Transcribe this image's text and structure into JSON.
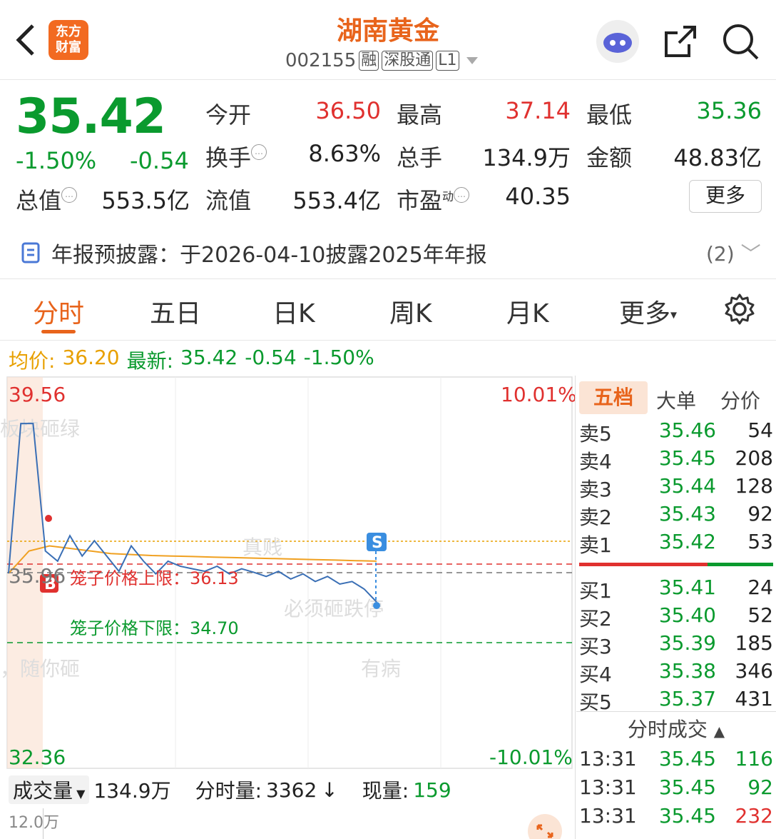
{
  "header": {
    "back_icon": "chevron-left-icon",
    "logo_text_line1": "东方",
    "logo_text_line2": "财富",
    "title": "湖南黄金",
    "code": "002155",
    "tags": [
      "融",
      "深股通",
      "L1"
    ],
    "icons": [
      "robot-avatar-icon",
      "share-icon",
      "search-icon"
    ]
  },
  "quote": {
    "price": "35.42",
    "change_pct": "-1.50%",
    "change_abs": "-0.54",
    "open_label": "今开",
    "open_value": "36.50",
    "high_label": "最高",
    "high_value": "37.14",
    "low_label": "最低",
    "low_value": "35.36",
    "turnover_label": "换手",
    "turnover_value": "8.63%",
    "volume_label": "总手",
    "volume_value": "134.9万",
    "amount_label": "金额",
    "amount_value": "48.83亿",
    "mktcap_label": "总值",
    "mktcap_value": "553.5亿",
    "float_label": "流值",
    "float_value": "553.4亿",
    "pe_label": "市盈",
    "pe_sup": "动",
    "pe_value": "40.35",
    "more_label": "更多"
  },
  "notice": {
    "text": "年报预披露：于2026-04-10披露2025年年报",
    "count": "(2)"
  },
  "tabs": [
    "分时",
    "五日",
    "日K",
    "周K",
    "月K",
    "更多"
  ],
  "avg": {
    "avg_label": "均价:",
    "avg_value": "36.20",
    "latest_label": "最新:",
    "latest_value": "35.42",
    "chg": "-0.54",
    "pct": "-1.50%"
  },
  "chart_labels": {
    "top_price": "39.56",
    "top_pct": "10.01%",
    "bottom_price": "32.36",
    "bottom_pct": "-10.01%",
    "ref_price": "35.96",
    "cage_upper": "笼子价格上限：36.13",
    "cage_lower": "笼子价格下限：34.70",
    "marker_s": "S",
    "marker_b": "B",
    "watermark_1": "板块砸绿",
    "watermark_2": "真贱",
    "watermark_3": "必须砸跌停",
    "watermark_4": "，随你砸",
    "watermark_5": "有病"
  },
  "chart_data": {
    "type": "line",
    "series": [
      {
        "values": [
          35.96,
          38.9,
          38.9,
          36.4,
          36.2,
          36.7,
          36.3,
          36.6,
          36.3,
          36.0,
          36.5,
          36.2,
          35.95,
          36.2,
          36.1,
          36.05,
          36.0,
          36.1,
          35.95,
          36.05,
          35.98,
          35.9,
          36.0,
          35.85,
          35.95,
          35.8,
          35.9,
          35.75,
          35.8,
          35.65,
          35.4
        ]
      },
      {
        "values": [
          35.96,
          36.4,
          36.5,
          36.45,
          36.4,
          36.35,
          36.33,
          36.31,
          36.3,
          36.29,
          36.28,
          36.27,
          36.26,
          36.25,
          36.24,
          36.23,
          36.22,
          36.21,
          36.2
        ]
      }
    ],
    "ylim": [
      32.36,
      39.56
    ],
    "grid": true
  },
  "orderbook": {
    "tabs": [
      "五档",
      "大单",
      "分价"
    ],
    "asks": [
      {
        "label": "卖5",
        "price": "35.46",
        "vol": "54"
      },
      {
        "label": "卖4",
        "price": "35.45",
        "vol": "208"
      },
      {
        "label": "卖3",
        "price": "35.44",
        "vol": "128"
      },
      {
        "label": "卖2",
        "price": "35.43",
        "vol": "92"
      },
      {
        "label": "卖1",
        "price": "35.42",
        "vol": "53"
      }
    ],
    "bids": [
      {
        "label": "买1",
        "price": "35.41",
        "vol": "24"
      },
      {
        "label": "买2",
        "price": "35.40",
        "vol": "52"
      },
      {
        "label": "买3",
        "price": "35.39",
        "vol": "185"
      },
      {
        "label": "买4",
        "price": "35.38",
        "vol": "346"
      },
      {
        "label": "买5",
        "price": "35.37",
        "vol": "431"
      }
    ],
    "trades_title": "分时成交",
    "trades": [
      {
        "time": "13:31",
        "price": "35.45",
        "vol": "116",
        "color": "#0a9a2e"
      },
      {
        "time": "13:31",
        "price": "35.45",
        "vol": "92",
        "color": "#0a9a2e"
      },
      {
        "time": "13:31",
        "price": "35.45",
        "vol": "232",
        "color": "#e0312f"
      }
    ]
  },
  "volume": {
    "selector": "成交量",
    "total": "134.9万",
    "minute_label": "分时量:",
    "minute_value": "3362",
    "arrow": "↓",
    "now_label": "现量:",
    "now_value": "159",
    "scale": "12.0万"
  },
  "colors": {
    "accent": "#e8641c",
    "up": "#e0312f",
    "down": "#0a9a2e"
  }
}
